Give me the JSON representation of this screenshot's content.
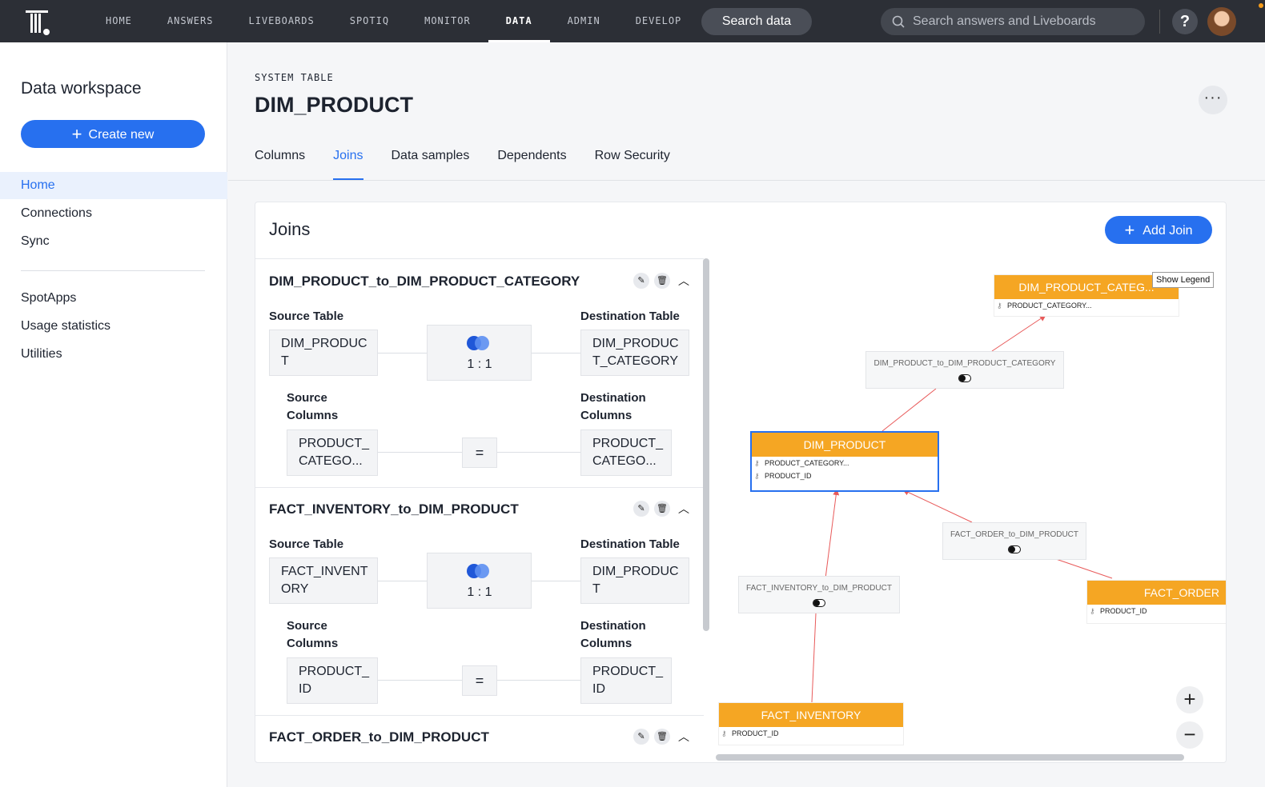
{
  "nav": {
    "items": [
      "HOME",
      "ANSWERS",
      "LIVEBOARDS",
      "SPOTIQ",
      "MONITOR",
      "DATA",
      "ADMIN",
      "DEVELOP"
    ],
    "active_index": 5,
    "search_data": "Search data",
    "search_placeholder": "Search answers and Liveboards",
    "help": "?"
  },
  "sidebar": {
    "title": "Data workspace",
    "create_label": "Create new",
    "items": [
      "Home",
      "Connections",
      "Sync",
      "SpotApps",
      "Usage statistics",
      "Utilities"
    ],
    "active": "Home"
  },
  "page": {
    "type_label": "SYSTEM TABLE",
    "title": "DIM_PRODUCT",
    "more": "···",
    "tabs": [
      "Columns",
      "Joins",
      "Data samples",
      "Dependents",
      "Row Security"
    ],
    "active_tab": "Joins"
  },
  "joins": {
    "title": "Joins",
    "add_label": "Add Join",
    "labels": {
      "source_table": "Source Table",
      "destination_table": "Destination Table",
      "source_columns_1": "Source",
      "source_columns_2": "Columns",
      "dest_columns_1": "Destination",
      "dest_columns_2": "Columns",
      "equals": "="
    },
    "list": [
      {
        "name": "DIM_PRODUCT_to_DIM_PRODUCT_CATEGORY",
        "source_table": "DIM_PRODUC T",
        "dest_table": "DIM_PRODUC T_CATEGORY",
        "ratio": "1 : 1",
        "source_col": "PRODUCT_ CATEGO...",
        "dest_col": "PRODUCT_ CATEGO..."
      },
      {
        "name": "FACT_INVENTORY_to_DIM_PRODUCT",
        "source_table": "FACT_INVENT ORY",
        "dest_table": "DIM_PRODUC T",
        "ratio": "1 : 1",
        "source_col": "PRODUCT_ ID",
        "dest_col": "PRODUCT_ ID"
      },
      {
        "name": "FACT_ORDER_to_DIM_PRODUCT"
      }
    ]
  },
  "diagram": {
    "legend": "Show Legend",
    "tables": {
      "dim_product_category": {
        "name": "DIM_PRODUCT_CATEG...",
        "columns": [
          "PRODUCT_CATEGORY..."
        ]
      },
      "dim_product": {
        "name": "DIM_PRODUCT",
        "columns": [
          "PRODUCT_CATEGORY...",
          "PRODUCT_ID"
        ]
      },
      "fact_order": {
        "name": "FACT_ORDER",
        "columns": [
          "PRODUCT_ID"
        ]
      },
      "fact_inventory": {
        "name": "FACT_INVENTORY",
        "columns": [
          "PRODUCT_ID"
        ]
      }
    },
    "join_labels": {
      "j1": "DIM_PRODUCT_to_DIM_PRODUCT_CATEGORY",
      "j2": "FACT_ORDER_to_DIM_PRODUCT",
      "j3": "FACT_INVENTORY_to_DIM_PRODUCT"
    },
    "zoom_in": "+",
    "zoom_out": "−"
  },
  "colors": {
    "accent": "#2770ef",
    "node": "#f5a623",
    "nav_bg": "#2c2f36",
    "link": "#e85a5a"
  }
}
